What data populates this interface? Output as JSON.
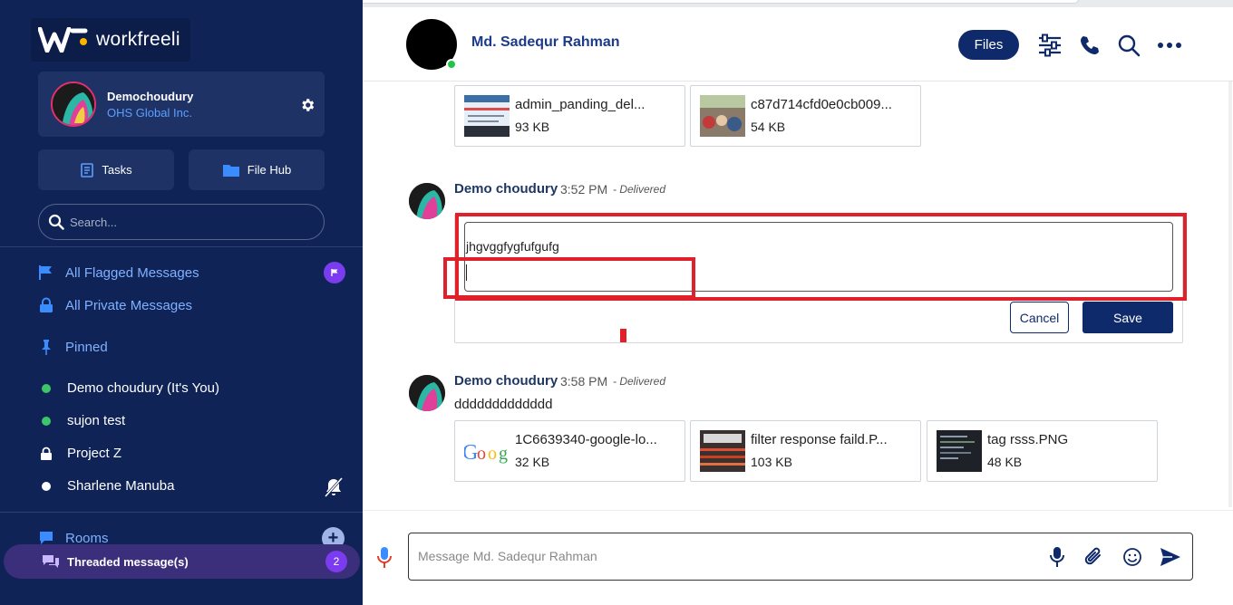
{
  "brand": {
    "name": "workfreeli"
  },
  "profile": {
    "name": "Demochoudury",
    "org": "OHS Global Inc."
  },
  "sidebar_buttons": {
    "tasks": "Tasks",
    "file_hub": "File Hub"
  },
  "search": {
    "placeholder": "Search..."
  },
  "nav": {
    "flagged": "All Flagged Messages",
    "private": "All Private Messages",
    "pinned": "Pinned",
    "contacts": [
      {
        "label": "Demo choudury (It's You)",
        "status": "online"
      },
      {
        "label": "sujon test",
        "status": "online"
      },
      {
        "label": "Project Z",
        "status": "locked"
      },
      {
        "label": "Sharlene Manuba",
        "status": "offline"
      }
    ],
    "rooms": "Rooms",
    "threaded": {
      "label": "Threaded message(s)",
      "count": "2"
    }
  },
  "header": {
    "name": "Md. Sadequr Rahman",
    "files_label": "Files"
  },
  "messages": [
    {
      "attachments": [
        {
          "name": "admin_panding_del...",
          "size": "93 KB"
        },
        {
          "name": "c87d714cfd0e0cb009...",
          "size": "54 KB"
        }
      ]
    },
    {
      "author": "Demo choudury",
      "time": "3:52 PM",
      "status": "- Delivered",
      "edit_value": "jhgvggfygfufgufg",
      "cancel_label": "Cancel",
      "save_label": "Save"
    },
    {
      "author": "Demo choudury",
      "time": "3:58 PM",
      "status": "- Delivered",
      "text": "ddddddddddddd",
      "attachments": [
        {
          "name": "1C6639340-google-lo...",
          "size": "32 KB"
        },
        {
          "name": "filter response faild.P...",
          "size": "103 KB"
        },
        {
          "name": "tag rsss.PNG",
          "size": "48 KB"
        }
      ]
    }
  ],
  "composer": {
    "placeholder": "Message Md. Sadequr Rahman"
  },
  "colors": {
    "sidebar": "#0f2356",
    "accent": "#0f2a6b",
    "highlight": "#e0202a",
    "online": "#22c24b"
  }
}
